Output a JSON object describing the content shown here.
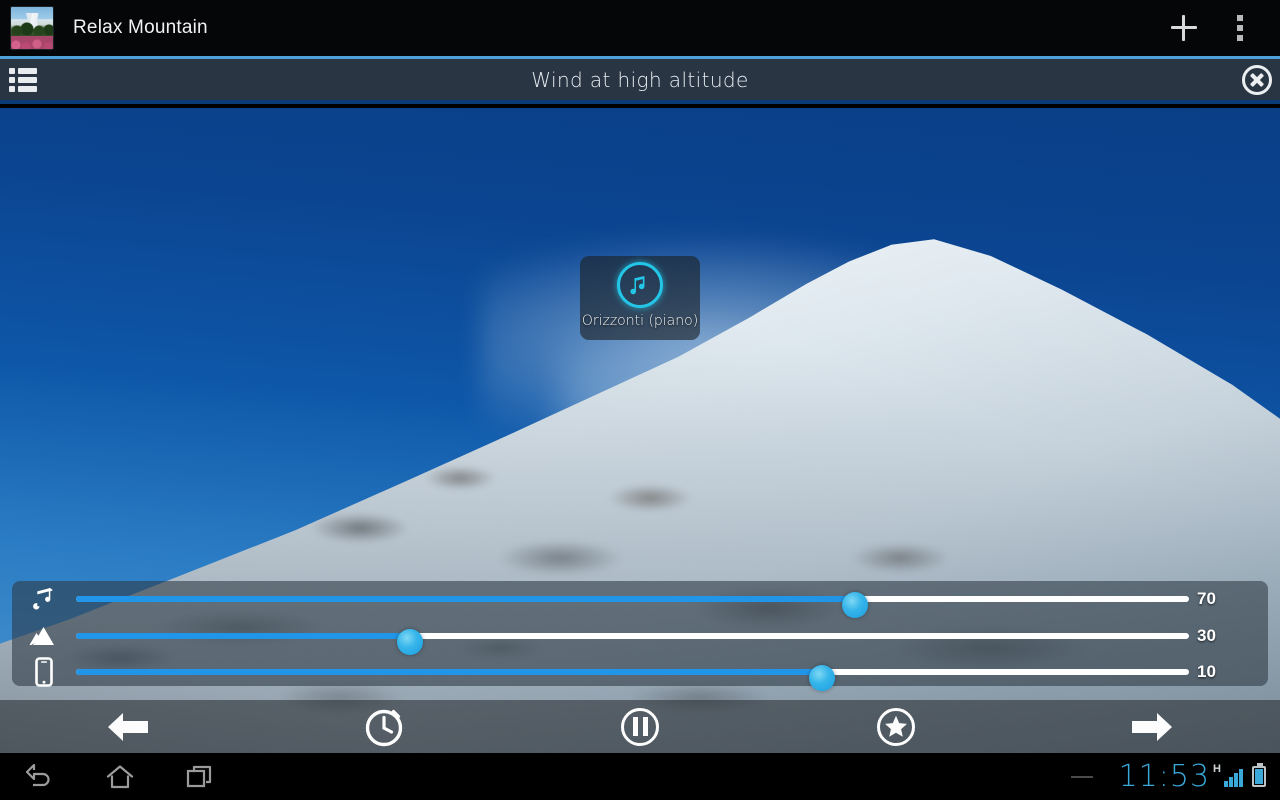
{
  "actionbar": {
    "app_title": "Relax Mountain",
    "app_icon_name": "app-thumbnail-mountain-flowers",
    "add_label": "+",
    "overflow_label": "",
    "accent_color": "#4ea0d8"
  },
  "subbar": {
    "scene_title": "Wind at high altitude",
    "list_icon": "list-icon",
    "close_icon": "close-circle-icon",
    "top_accent_color": "#4ea0d8",
    "bottom_accent_color": "#0a3b76"
  },
  "scene": {
    "sound_widget": {
      "label": "Orizzonti (piano)",
      "icon": "music-note-circle-icon",
      "icon_color": "#24c6e8"
    }
  },
  "mixer": {
    "rows": [
      {
        "icon": "music-note-icon",
        "name": "music-volume",
        "value": 70,
        "value_label": "70"
      },
      {
        "icon": "mountain-icon",
        "name": "ambience-volume",
        "value": 30,
        "value_label": "30"
      },
      {
        "icon": "device-icon",
        "name": "device-volume",
        "value": 10,
        "value_label": "10"
      }
    ],
    "track_color": "#ffffff",
    "fill_color": "#2196e8"
  },
  "transport": {
    "buttons": [
      {
        "name": "previous-button",
        "icon": "arrow-left-icon"
      },
      {
        "name": "timer-button",
        "icon": "clock-icon"
      },
      {
        "name": "pause-button",
        "icon": "pause-circle-icon"
      },
      {
        "name": "favorite-button",
        "icon": "star-circle-icon"
      },
      {
        "name": "next-button",
        "icon": "arrow-right-icon"
      }
    ]
  },
  "systembar": {
    "back_icon": "back-icon",
    "home_icon": "home-icon",
    "recents_icon": "recents-icon",
    "clock": "11:53",
    "network_type": "H",
    "signal_icon": "signal-bars-icon",
    "battery_icon": "battery-icon",
    "clock_color": "#3aa8d8"
  }
}
